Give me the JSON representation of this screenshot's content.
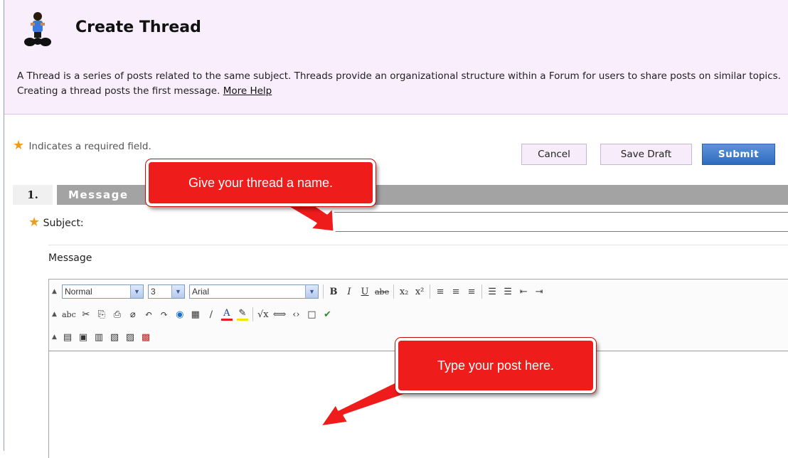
{
  "header": {
    "title": "Create Thread",
    "logo_icon": "forum-user-icon",
    "description": "A Thread is a series of posts related to the same subject. Threads provide an organizational structure within a Forum for users to share posts on similar topics. Creating a thread posts the first message.",
    "help_link": "More Help"
  },
  "form": {
    "required_note": "Indicates a required field.",
    "required_star": "★",
    "buttons": {
      "cancel": "Cancel",
      "save_draft": "Save Draft",
      "submit": "Submit"
    },
    "section": {
      "number": "1.",
      "title": "Message"
    },
    "subject_label": "Subject:",
    "subject_value": "",
    "message_label": "Message"
  },
  "editor": {
    "style_value": "Normal",
    "size_value": "3",
    "font_value": "Arial",
    "row1_buttons": [
      "B",
      "I",
      "U",
      "abe",
      "x₂",
      "x²",
      "≡",
      "≡",
      "≡",
      "☰",
      "☰",
      "⇤",
      "⇥"
    ],
    "row2_buttons": [
      "abc",
      "✂",
      "⎘",
      "⎙",
      "⌀",
      "↶",
      "↷",
      "◉",
      "▦",
      "∕",
      "A",
      "✎",
      "√x",
      "⟺",
      "‹›",
      "□",
      "✔"
    ],
    "row3_buttons": [
      "▤",
      "▣",
      "▥",
      "▧",
      "▨",
      "▩"
    ],
    "content": ""
  },
  "callouts": {
    "name": "Give your thread a name.",
    "post": "Type your post here."
  },
  "colors": {
    "header_bg": "#f8eefc",
    "submit_bg": "#3a76c9",
    "callout_red": "#ef1c1c",
    "star": "#f29b1b"
  }
}
